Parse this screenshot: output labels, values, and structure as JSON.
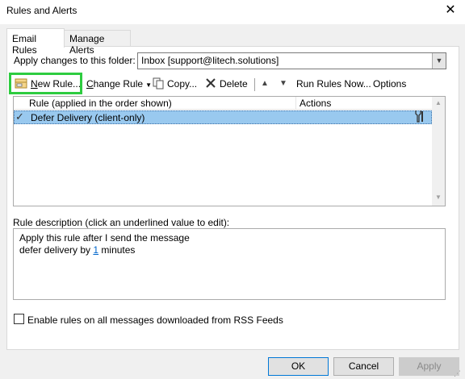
{
  "window": {
    "title": "Rules and Alerts",
    "close_glyph": "✕"
  },
  "tabs": [
    {
      "label": "Email Rules",
      "active": true
    },
    {
      "label": "Manage Alerts",
      "active": false
    }
  ],
  "folder": {
    "label": "Apply changes to this folder:",
    "value": "Inbox [support@litech.solutions]"
  },
  "toolbar": {
    "new_rule": "New Rule...",
    "change_rule": "Change Rule",
    "copy": "Copy...",
    "delete": "Delete",
    "run_rules_now": "Run Rules Now...",
    "options": "Options"
  },
  "rules_table": {
    "columns": [
      "Rule (applied in the order shown)",
      "Actions"
    ],
    "rows": [
      {
        "enabled": true,
        "name": "Defer Delivery  (client-only)",
        "selected": true
      }
    ]
  },
  "description": {
    "label": "Rule description (click an underlined value to edit):",
    "line1": "Apply this rule after I send the message",
    "line2_prefix": "defer delivery by ",
    "line2_value": "1",
    "line2_suffix": " minutes"
  },
  "rss": {
    "label": "Enable rules on all messages downloaded from RSS Feeds",
    "checked": false
  },
  "buttons": {
    "ok": "OK",
    "cancel": "Cancel",
    "apply": "Apply"
  },
  "colors": {
    "selection": "#99c9ef",
    "highlight_box": "#2ecc40",
    "link": "#0066cc",
    "primary_border": "#0078d7"
  },
  "icons": [
    "new-rule-icon",
    "copy-icon",
    "delete-icon",
    "move-up-icon",
    "move-down-icon",
    "tools-icon",
    "close-icon"
  ]
}
